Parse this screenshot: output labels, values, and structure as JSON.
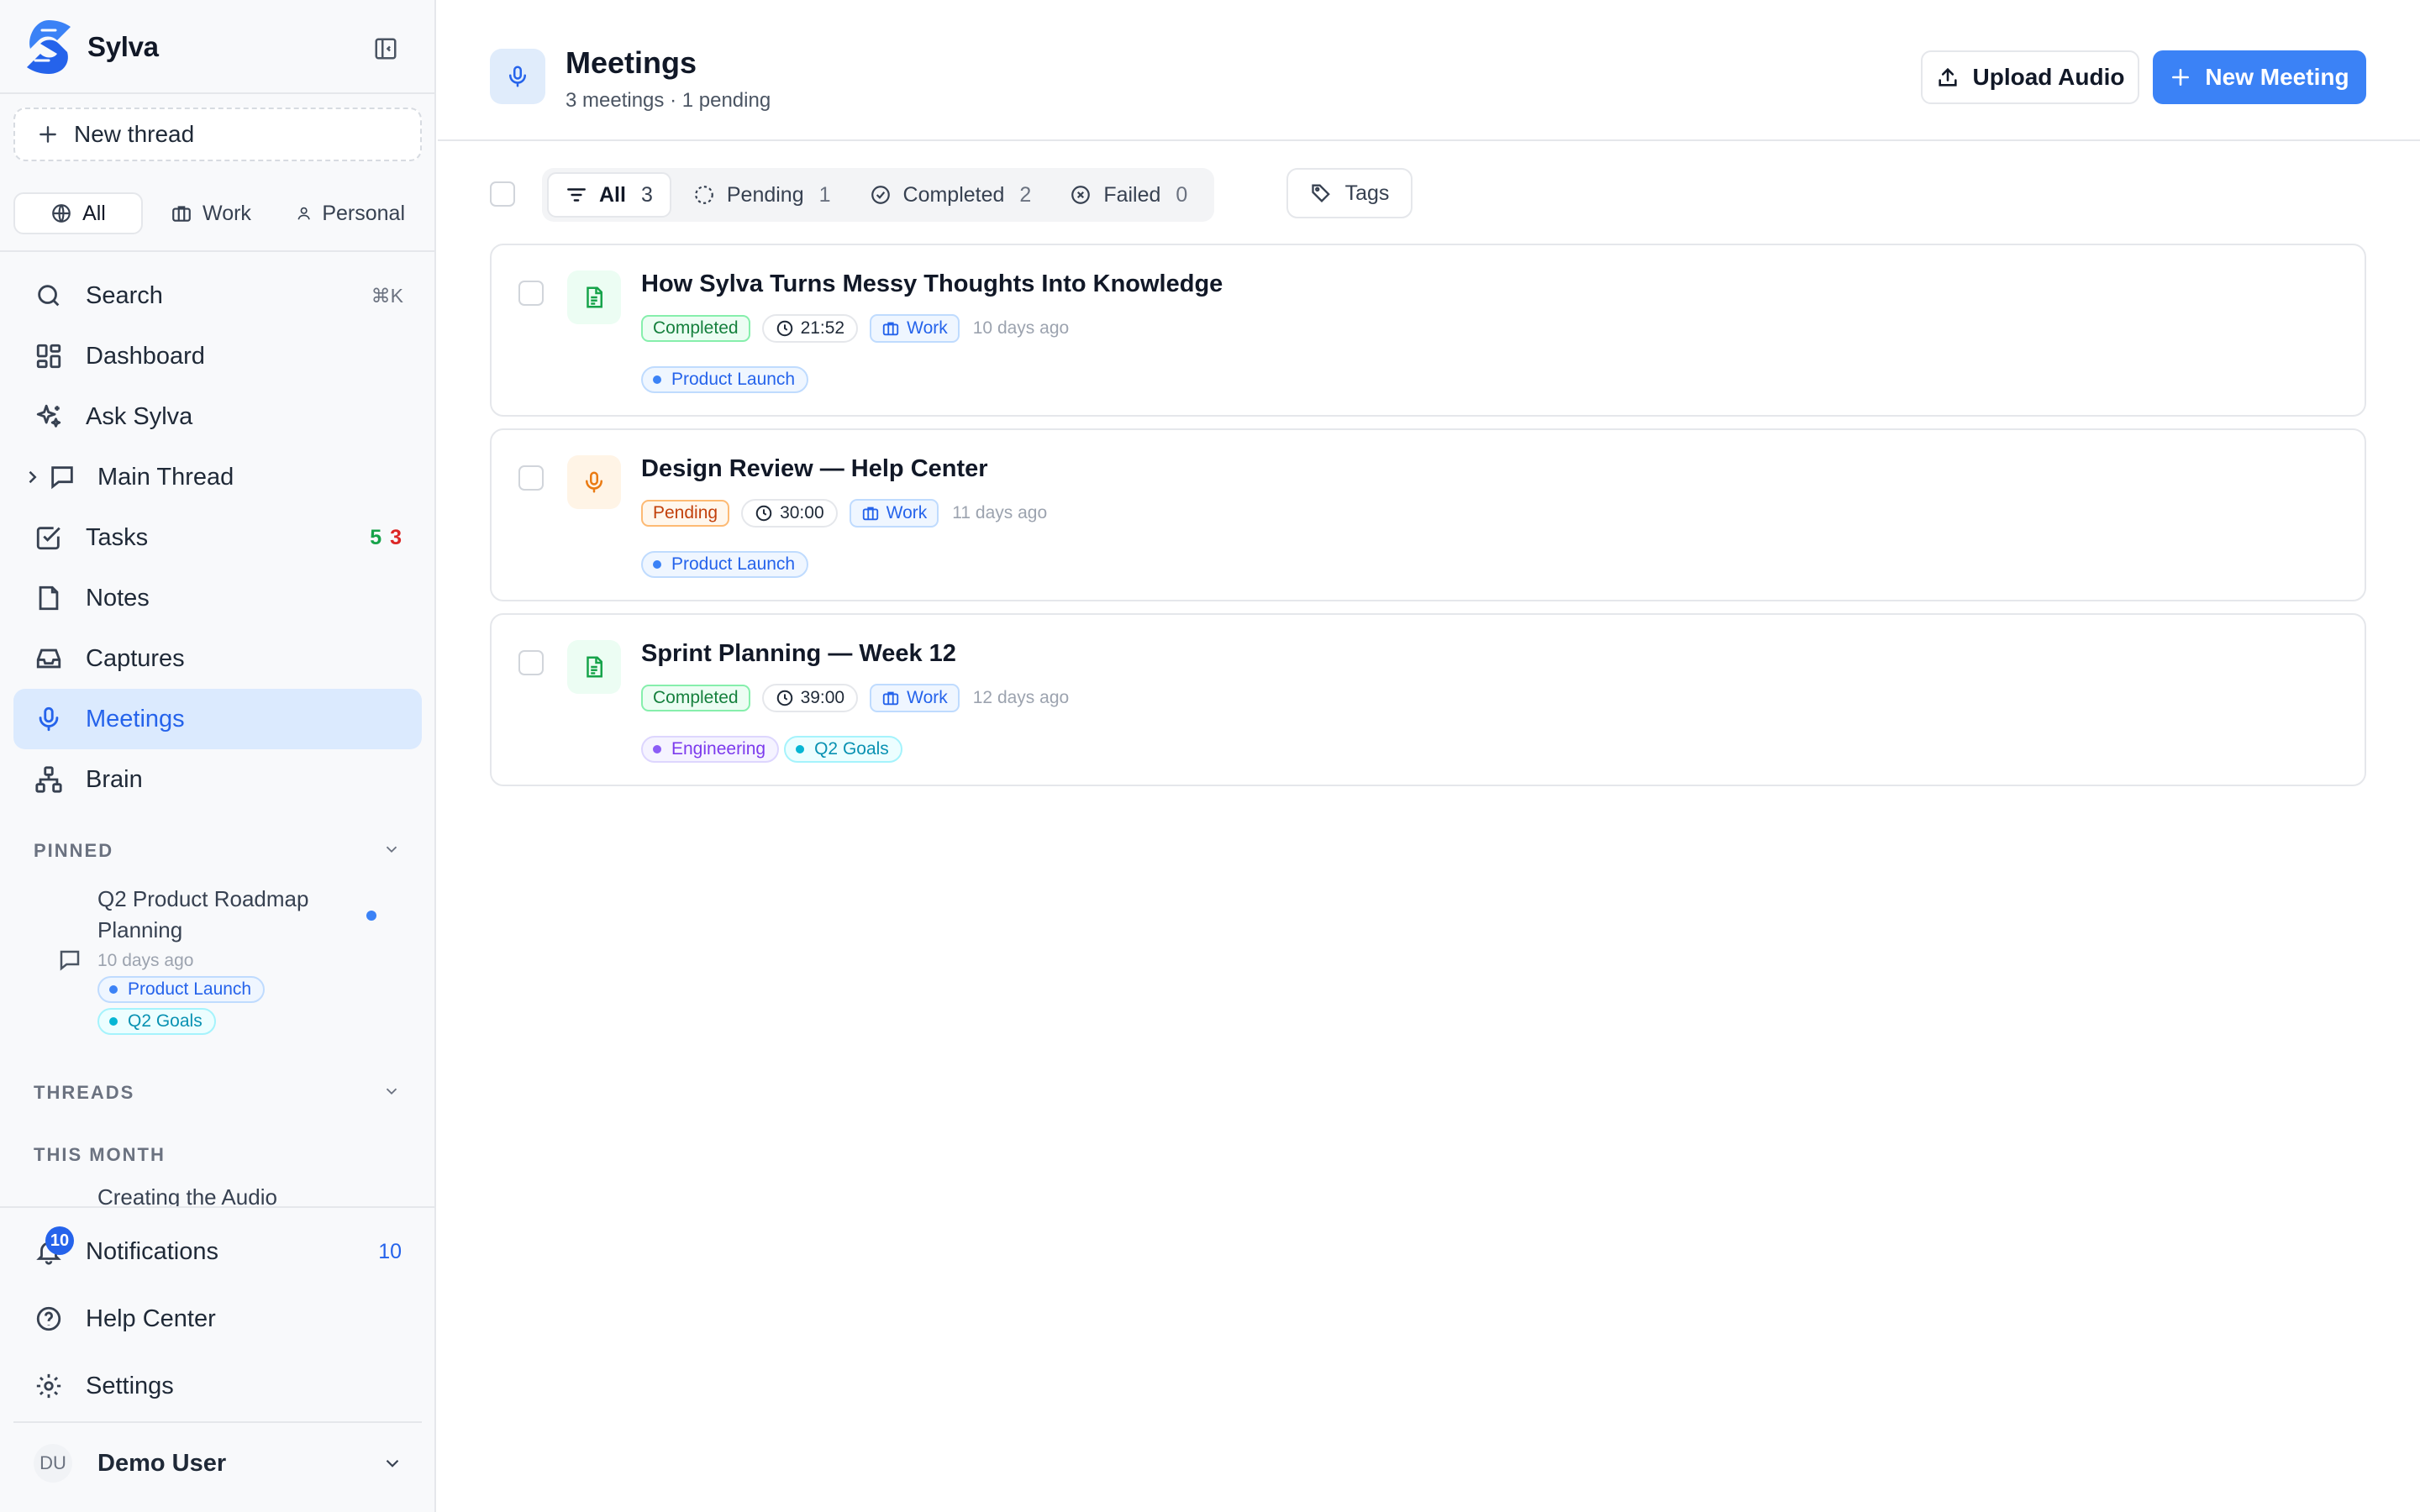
{
  "app": {
    "name": "Sylva",
    "accent": "#3b82f6"
  },
  "sidebar": {
    "new_thread": "New thread",
    "scopes": [
      {
        "label": "All",
        "icon": "globe-icon",
        "active": true
      },
      {
        "label": "Work",
        "icon": "briefcase-icon"
      },
      {
        "label": "Personal",
        "icon": "user-icon"
      }
    ],
    "nav": {
      "search": {
        "label": "Search",
        "shortcut": "⌘K"
      },
      "dashboard": {
        "label": "Dashboard"
      },
      "ask": {
        "label": "Ask Sylva"
      },
      "main_thread": {
        "label": "Main Thread"
      },
      "tasks": {
        "label": "Tasks",
        "count_green": "5",
        "count_red": "3"
      },
      "notes": {
        "label": "Notes"
      },
      "captures": {
        "label": "Captures"
      },
      "meetings": {
        "label": "Meetings",
        "active": true
      },
      "brain": {
        "label": "Brain"
      }
    },
    "pinned": {
      "label": "PINNED",
      "item": {
        "title": "Q2 Product Roadmap Planning",
        "time": "10 days ago",
        "tags": [
          "Product Launch",
          "Q2 Goals"
        ]
      }
    },
    "threads_label": "THREADS",
    "this_month_label": "THIS MONTH",
    "this_month_item": "Creating the Audio",
    "footer": {
      "notifications": {
        "label": "Notifications",
        "badge": "10",
        "count": "10"
      },
      "help": {
        "label": "Help Center"
      },
      "settings": {
        "label": "Settings"
      }
    },
    "user": {
      "initials": "DU",
      "name": "Demo User"
    }
  },
  "header": {
    "title": "Meetings",
    "subtitle": "3 meetings · 1 pending",
    "upload_label": "Upload Audio",
    "new_label": "New Meeting"
  },
  "filters": {
    "chips": [
      {
        "label": "All",
        "count": "3",
        "active": true
      },
      {
        "label": "Pending",
        "count": "1"
      },
      {
        "label": "Completed",
        "count": "2"
      },
      {
        "label": "Failed",
        "count": "0"
      }
    ],
    "tags_label": "Tags"
  },
  "meetings": [
    {
      "title": "How Sylva Turns Messy Thoughts Into Knowledge",
      "status": "Completed",
      "duration": "21:52",
      "scope": "Work",
      "ago": "10 days ago",
      "icon": "document-icon",
      "tags": [
        "Product Launch"
      ]
    },
    {
      "title": "Design Review — Help Center",
      "status": "Pending",
      "duration": "30:00",
      "scope": "Work",
      "ago": "11 days ago",
      "icon": "microphone-icon",
      "tags": [
        "Product Launch"
      ]
    },
    {
      "title": "Sprint Planning — Week 12",
      "status": "Completed",
      "duration": "39:00",
      "scope": "Work",
      "ago": "12 days ago",
      "icon": "document-icon",
      "tags": [
        "Engineering",
        "Q2 Goals"
      ]
    }
  ]
}
